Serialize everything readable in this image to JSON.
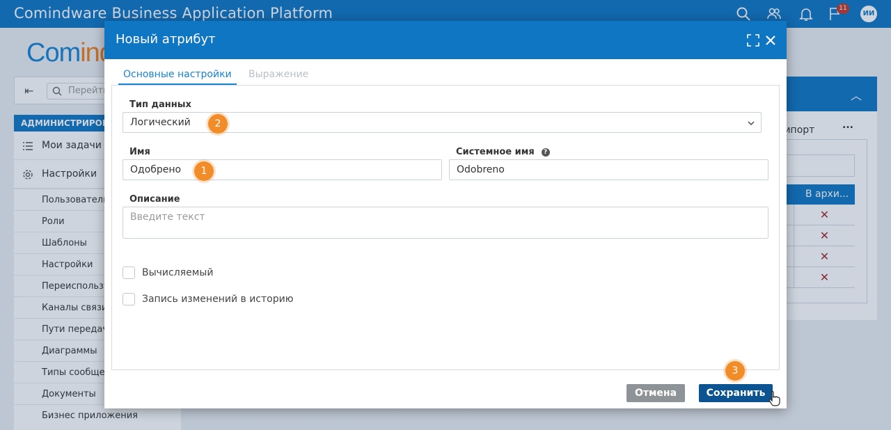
{
  "app": {
    "title": "Comindware Business Application Platform",
    "notifications_count": "11",
    "user_initials": "ИИ",
    "accent_color": "#0f76c3",
    "icons": [
      "search-icon",
      "users-icon",
      "bell-icon",
      "flag-icon"
    ]
  },
  "logo": {
    "part1": "Com",
    "part2": "ind"
  },
  "sidebar": {
    "search_placeholder": "Перейти",
    "section": "АДМИНИСТРИРОВА",
    "main_items": [
      {
        "label": "Мои задачи",
        "icon": "task-list-icon"
      },
      {
        "label": "Настройки",
        "icon": "gear-icon"
      }
    ],
    "sub_items": [
      "Пользователи",
      "Роли",
      "Шаблоны",
      "Настройки",
      "Переиспользу",
      "Каналы связи",
      "Пути передачи",
      "Диаграммы",
      "Типы сообщен",
      "Документы",
      "Бизнес приложения"
    ]
  },
  "right_panel": {
    "import_label": "мпорт",
    "more_label": "...",
    "column_header": "В архи...",
    "row_marks": [
      "✕",
      "✕",
      "✕",
      "✕"
    ]
  },
  "dialog": {
    "title": "Новый атрибут",
    "tabs": [
      {
        "label": "Основные настройки",
        "active": true
      },
      {
        "label": "Выражение",
        "active": false
      }
    ],
    "data_type": {
      "label": "Тип данных",
      "value": "Логический"
    },
    "name": {
      "label": "Имя",
      "value": "Одобрено"
    },
    "system_name": {
      "label": "Системное имя",
      "value": "Odobreno",
      "help": "?"
    },
    "description": {
      "label": "Описание",
      "placeholder": "Введите текст"
    },
    "checkboxes": [
      {
        "label": "Вычисляемый",
        "checked": false
      },
      {
        "label": "Запись изменений в историю",
        "checked": false
      }
    ],
    "cancel_label": "Отмена",
    "save_label": "Сохранить",
    "steps": [
      "1",
      "2",
      "3"
    ]
  }
}
